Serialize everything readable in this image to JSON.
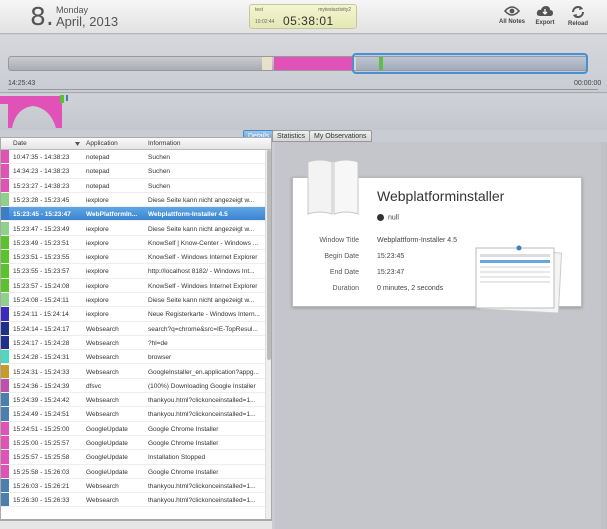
{
  "header": {
    "day_number": "8.",
    "weekday": "Monday",
    "month_year": "April, 2013",
    "clock_label_left": "test",
    "clock_label_right": "mytestactivity2",
    "clock_small_time": "10:02:44",
    "clock_time": "05:38:01",
    "buttons": [
      {
        "label": "All Notes",
        "icon": "eye-icon"
      },
      {
        "label": "Export",
        "icon": "cloud-download-icon"
      },
      {
        "label": "Reload",
        "icon": "refresh-icon"
      }
    ]
  },
  "timeline": {
    "start_label": "14:25:43",
    "end_label": "00:00:00",
    "segment_colors": [
      "#e0d8c4",
      "#e052b8",
      "#8fd08a",
      "#3a7fc4"
    ]
  },
  "tabs": [
    {
      "label": "Details",
      "active": true
    },
    {
      "label": "Statistics",
      "active": false
    },
    {
      "label": "My Observations",
      "active": false
    }
  ],
  "list": {
    "columns": [
      "Date",
      "Application",
      "Information"
    ],
    "rows": [
      {
        "date": "10:47:35 - 14:38:23",
        "app": "notepad",
        "info": "Suchen",
        "color": "#e052b8"
      },
      {
        "date": "14:34:23 - 14:38:23",
        "app": "notepad",
        "info": "Suchen",
        "color": "#e052b8"
      },
      {
        "date": "15:23:27 - 14:38:23",
        "app": "notepad",
        "info": "Suchen",
        "color": "#e052b8"
      },
      {
        "date": "15:23:28 - 15:23:45",
        "app": "iexplore",
        "info": "Diese Seite kann nicht angezeigt w...",
        "color": "#8fd08a"
      },
      {
        "date": "15:23:45 - 15:23:47",
        "app": "WebPlatformIn...",
        "info": "Webplattform-Installer 4.5",
        "color": "#3a7fc4",
        "selected": true
      },
      {
        "date": "15:23:47 - 15:23:49",
        "app": "iexplore",
        "info": "Diese Seite kann nicht angezeigt w...",
        "color": "#8fd08a"
      },
      {
        "date": "15:23:49 - 15:23:51",
        "app": "iexplore",
        "info": "KnowSelf | Know-Center - Windows ...",
        "color": "#5ac22a"
      },
      {
        "date": "15:23:51 - 15:23:55",
        "app": "iexplore",
        "info": "KnowSelf - Windows Internet Explorer",
        "color": "#5ac22a"
      },
      {
        "date": "15:23:55 - 15:23:57",
        "app": "iexplore",
        "info": "http://localhost 8182/ - Windows Int...",
        "color": "#5ac22a"
      },
      {
        "date": "15:23:57 - 15:24:08",
        "app": "iexplore",
        "info": "KnowSelf - Windows Internet Explorer",
        "color": "#5ac22a"
      },
      {
        "date": "15:24:08 - 15:24:11",
        "app": "iexplore",
        "info": "Diese Seite kann nicht angezeigt w...",
        "color": "#8fd08a"
      },
      {
        "date": "15:24:11 - 15:24:14",
        "app": "iexplore",
        "info": "Neue Registerkarte - Windows Intern...",
        "color": "#3a2cb8"
      },
      {
        "date": "15:24:14 - 15:24:17",
        "app": "Websearch",
        "info": "search?q=chrome&src=IE-TopResul...",
        "color": "#1f2f8a"
      },
      {
        "date": "15:24:17 - 15:24:28",
        "app": "Websearch",
        "info": "?hl=de",
        "color": "#1f2f8a"
      },
      {
        "date": "15:24:28 - 15:24:31",
        "app": "Websearch",
        "info": "browser",
        "color": "#4fd8c0"
      },
      {
        "date": "15:24:31 - 15:24:33",
        "app": "Websearch",
        "info": "GoogleInstaller_en.application?appg...",
        "color": "#c89a2a"
      },
      {
        "date": "15:24:36 - 15:24:39",
        "app": "dfsvc",
        "info": "(100%) Downloading Google Installer",
        "color": "#c050b0"
      },
      {
        "date": "15:24:39 - 15:24:42",
        "app": "Websearch",
        "info": "thankyou.html?clickonceinstalled=1...",
        "color": "#4a7fb0"
      },
      {
        "date": "15:24:49 - 15:24:51",
        "app": "Websearch",
        "info": "thankyou.html?clickonceinstalled=1...",
        "color": "#4a7fb0"
      },
      {
        "date": "15:24:51 - 15:25:00",
        "app": "GoogleUpdate",
        "info": "Google Chrome Installer",
        "color": "#e052b8"
      },
      {
        "date": "15:25:00 - 15:25:57",
        "app": "GoogleUpdate",
        "info": "Google Chrome Installer",
        "color": "#e052b8"
      },
      {
        "date": "15:25:57 - 15:25:58",
        "app": "GoogleUpdate",
        "info": "Installation Stopped",
        "color": "#e052b8"
      },
      {
        "date": "15:25:58 - 15:26:03",
        "app": "GoogleUpdate",
        "info": "Google Chrome Installer",
        "color": "#e052b8"
      },
      {
        "date": "15:26:03 - 15:26:21",
        "app": "Websearch",
        "info": "thankyou.html?clickonceinstalled=1...",
        "color": "#4a7fb0"
      },
      {
        "date": "15:26:30 - 15:26:33",
        "app": "Websearch",
        "info": "thankyou.html?clickonceinstalled=1...",
        "color": "#4a7fb0"
      }
    ]
  },
  "details": {
    "title": "Webplatforminstaller",
    "status": "null",
    "fields": [
      {
        "key": "Window Title",
        "value": "Webplattform-Installer 4.5"
      },
      {
        "key": "Begin Date",
        "value": "15:23:45"
      },
      {
        "key": "End Date",
        "value": "15:23:47"
      },
      {
        "key": "Duration",
        "value": "0 minutes, 2 seconds"
      }
    ]
  }
}
